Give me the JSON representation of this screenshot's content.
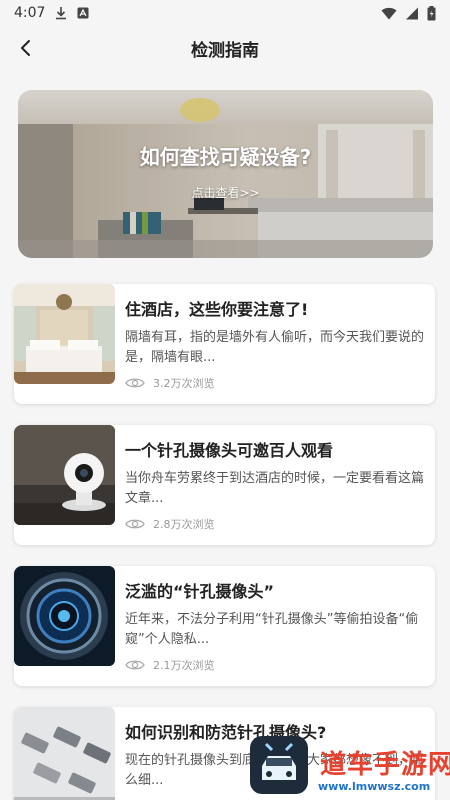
{
  "status_bar": {
    "time": "4:07"
  },
  "header": {
    "title": "检测指南"
  },
  "banner": {
    "title": "如何查找可疑设备?",
    "link": "点击查看>>"
  },
  "articles": [
    {
      "title": "住酒店，这些你要注意了!",
      "desc": "隔墙有耳，指的是墙外有人偷听，而今天我们要说的是，隔墙有眼...",
      "views": "3.2万次浏览",
      "thumb": "hotel-room-photo"
    },
    {
      "title": "一个针孔摄像头可邀百人观看",
      "desc": "当你舟车劳累终于到达酒店的时候，一定要看看这篇文章...",
      "views": "2.8万次浏览",
      "thumb": "security-camera-photo"
    },
    {
      "title": "泛滥的“针孔摄像头”",
      "desc": "近年来，不法分子利用“针孔摄像头”等偷拍设备“偷窥”个人隐私...",
      "views": "2.1万次浏览",
      "thumb": "camera-lens-photo"
    },
    {
      "title": "如何识别和防范针孔摄像头?",
      "desc": "现在的针孔摄像头到底有多小，大家都想像不到，那么细...",
      "views": "",
      "thumb": "cctv-cameras-photo"
    }
  ],
  "watermark": {
    "brand": "道车手游网",
    "url": "www.lmwwsz.com"
  },
  "colors": {
    "background": "#f5f5f5",
    "card": "#ffffff",
    "text": "#222222",
    "muted": "#999999",
    "watermark_red": "#e6422f",
    "watermark_blue": "#1e73c9"
  }
}
